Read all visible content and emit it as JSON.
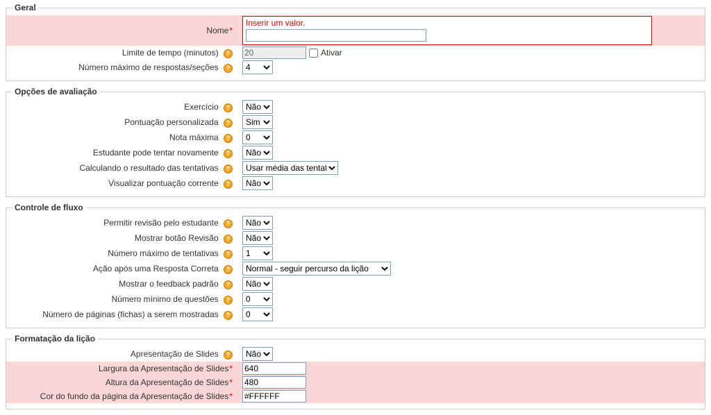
{
  "nao": "Não",
  "sim": "Sim",
  "sections": {
    "geral": {
      "legend": "Geral",
      "nome": {
        "label": "Nome",
        "error": "Inserir um valor.",
        "value": ""
      },
      "limite": {
        "label": "Limite de tempo (minutos)",
        "value": "20",
        "ativar": "Ativar"
      },
      "respostas": {
        "label": "Número máximo de respostas/seções",
        "value": "4"
      }
    },
    "avaliacao": {
      "legend": "Opções de avaliação",
      "exercicio": {
        "label": "Exercício",
        "value": "Não"
      },
      "pont_pers": {
        "label": "Pontuação personalizada",
        "value": "Sim"
      },
      "nota_max": {
        "label": "Nota máxima",
        "value": "0"
      },
      "tentar_nov": {
        "label": "Estudante pode tentar novamente",
        "value": "Não"
      },
      "calc_tent": {
        "label": "Calculando o resultado das tentativas",
        "value": "Usar média das tentativas"
      },
      "vis_pont": {
        "label": "Visualizar pontuação corrente",
        "value": "Não"
      }
    },
    "fluxo": {
      "legend": "Controle de fluxo",
      "revisao_est": {
        "label": "Permitir revisão pelo estudante",
        "value": "Não"
      },
      "botao_rev": {
        "label": "Mostrar botão Revisão",
        "value": "Não"
      },
      "max_tent": {
        "label": "Número máximo de tentativas",
        "value": "1"
      },
      "acao_correta": {
        "label": "Ação após uma Resposta Correta",
        "value": "Normal - seguir percurso da lição"
      },
      "feedback": {
        "label": "Mostrar o feedback padrão",
        "value": "Não"
      },
      "min_quest": {
        "label": "Número mínimo de questões",
        "value": "0"
      },
      "pag_mostradas": {
        "label": "Número de páginas (fichas) a serem mostradas",
        "value": "0"
      }
    },
    "formatacao": {
      "legend": "Formatação da lição",
      "apres_slides": {
        "label": "Apresentação de Slides",
        "value": "Não"
      },
      "largura": {
        "label": "Largura da Apresentação de Slides",
        "value": "640"
      },
      "altura": {
        "label": "Altura da Apresentação de Slides",
        "value": "480"
      },
      "cor_fundo": {
        "label": "Cor do fundo da página da Apresentação de Slides",
        "value": "#FFFFFF"
      }
    }
  }
}
